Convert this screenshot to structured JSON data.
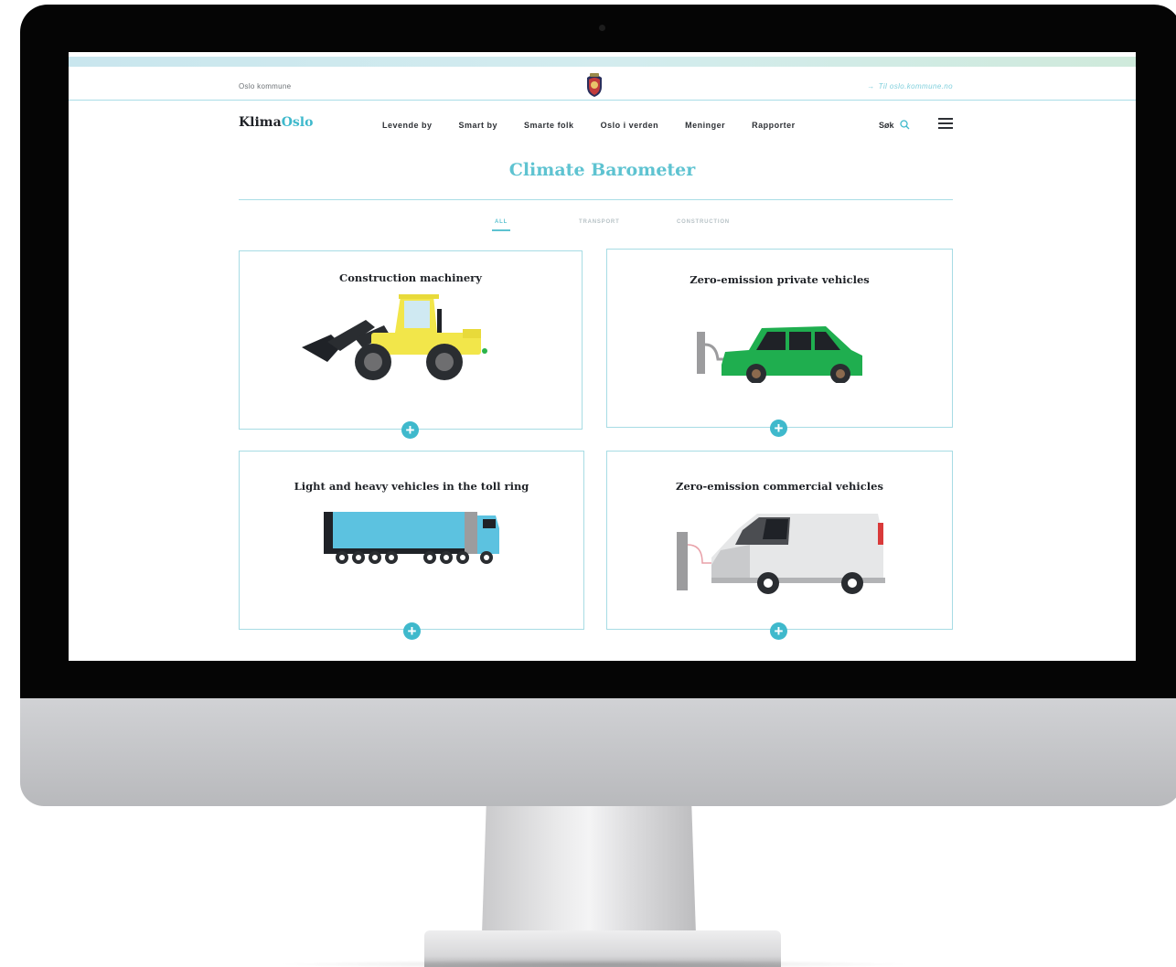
{
  "header": {
    "org_name": "Oslo kommune",
    "external_link": "Til oslo.kommune.no",
    "logo_part1": "Klima",
    "logo_part2": "Oslo"
  },
  "nav": {
    "items": [
      "Levende by",
      "Smart by",
      "Smarte folk",
      "Oslo i verden",
      "Meninger",
      "Rapporter"
    ],
    "search_label": "Søk"
  },
  "page": {
    "title": "Climate Barometer"
  },
  "filters": [
    {
      "label": "ALL",
      "active": true
    },
    {
      "label": "TRANSPORT",
      "active": false
    },
    {
      "label": "CONSTRUCTION",
      "active": false
    }
  ],
  "cards": [
    {
      "title": "Construction machinery",
      "icon": "wheel-loader-icon"
    },
    {
      "title": "Zero-emission private vehicles",
      "icon": "electric-car-icon"
    },
    {
      "title": "Light and heavy vehicles in the toll ring",
      "icon": "truck-icon"
    },
    {
      "title": "Zero-emission commercial vehicles",
      "icon": "electric-van-icon"
    }
  ],
  "colors": {
    "accent": "#3fb9cc",
    "title": "#5ec3d1",
    "border": "#a7dce4",
    "loader": "#f2e64a",
    "car": "#1fae4f",
    "truck": "#5cc2e0",
    "van": "#e6e7e8"
  }
}
